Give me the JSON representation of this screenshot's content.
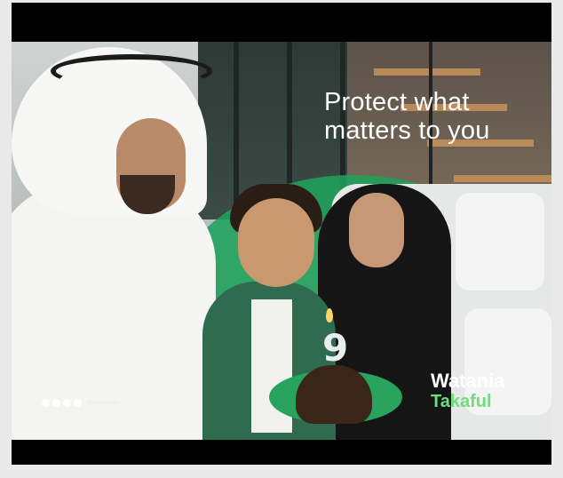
{
  "ad": {
    "headline_line1": "Protect what",
    "headline_line2": "matters to you",
    "brand_name": "Watania",
    "brand_sub": "Takaful",
    "social_handle": "@mywatania",
    "candle_number": "9"
  },
  "colors": {
    "brand_green": "#1fa25b",
    "brand_light_green": "#6be07a",
    "letterbox": "#000000"
  },
  "icons": [
    "instagram-icon",
    "twitter-icon",
    "facebook-icon",
    "youtube-icon"
  ]
}
